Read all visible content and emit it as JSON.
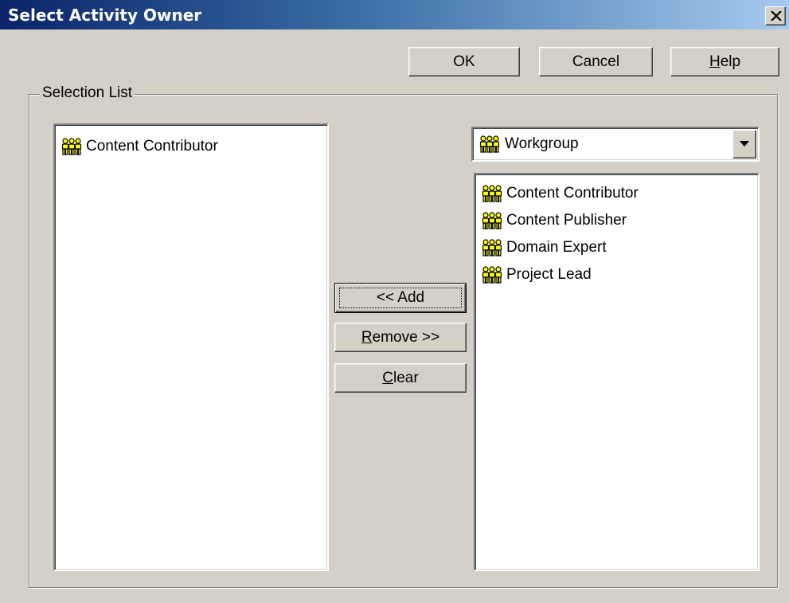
{
  "window": {
    "title": "Select Activity Owner"
  },
  "buttons": {
    "ok_label": "OK",
    "cancel_label": "Cancel",
    "help_label_mnemonic": "H",
    "help_label_rest": "elp",
    "add_label": "<< Add",
    "remove_label_mnemonic": "R",
    "remove_label_rest": "emove >>",
    "clear_label_mnemonic": "C",
    "clear_label_rest": "lear"
  },
  "selection_group": {
    "label": "Selection List"
  },
  "selected_list": {
    "items": [
      {
        "label": "Content Contributor",
        "icon": "workgroup-icon"
      }
    ]
  },
  "source_filter": {
    "selected": "Workgroup",
    "icon": "workgroup-icon"
  },
  "available_list": {
    "items": [
      {
        "label": "Content Contributor",
        "icon": "workgroup-icon"
      },
      {
        "label": "Content Publisher",
        "icon": "workgroup-icon"
      },
      {
        "label": "Domain Expert",
        "icon": "workgroup-icon"
      },
      {
        "label": "Project Lead",
        "icon": "workgroup-icon"
      }
    ]
  },
  "colors": {
    "titlebar_start": "#0a246a",
    "titlebar_end": "#a6caf0",
    "dialog_face": "#d4d0c8",
    "icon_fill": "#ffff00"
  }
}
